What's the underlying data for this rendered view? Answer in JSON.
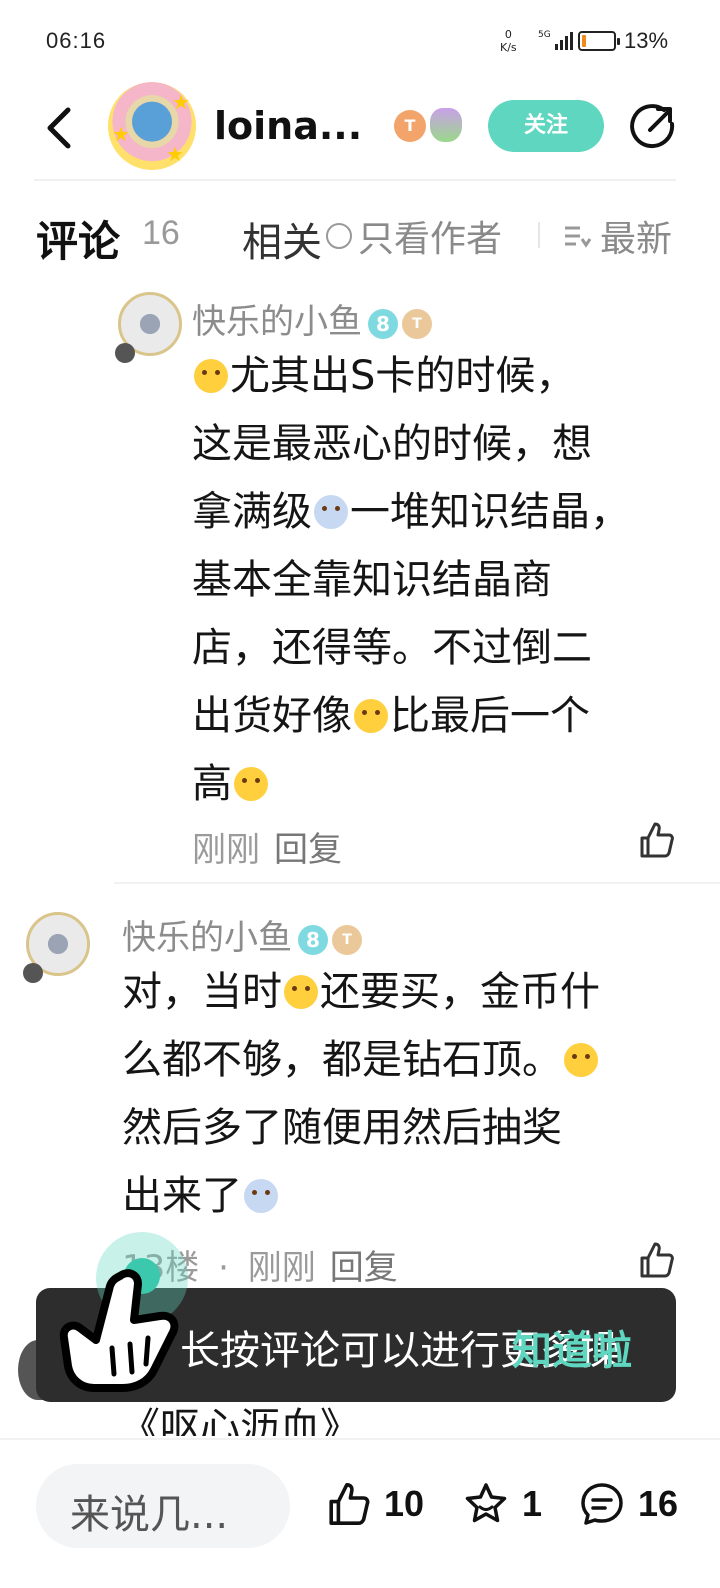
{
  "status_bar": {
    "time": "06:16",
    "net_speed_value": "0",
    "net_speed_unit": "K/s",
    "signal_label": "5G",
    "battery_percent": "13%",
    "battery_level": 0.13
  },
  "header": {
    "username": "loina...",
    "badge_t_label": "T",
    "follow_label": "关注"
  },
  "tabs": {
    "comments_label": "评论",
    "comments_count": "16",
    "related_label": "相关",
    "author_only_label": "只看作者",
    "sort_label": "最新"
  },
  "comments": [
    {
      "name": "快乐的小鱼",
      "level": "8",
      "t_badge": "T",
      "lines": [
        "尤其出S卡的时候，",
        "这是最恶心的时候，想",
        "拿满级",
        "一堆知识结晶，",
        "基本全靠知识结晶商",
        "店，还得等。不过倒二",
        "出货好像",
        "比最后一个",
        "高"
      ],
      "time": "刚刚",
      "reply_label": "回复"
    },
    {
      "name": "快乐的小鱼",
      "level": "8",
      "t_badge": "T",
      "lines": [
        "对，当时",
        "还要买，金币什",
        "么都不够，都是钻石顶。",
        "然后多了随便用然后抽奖",
        "出来了"
      ],
      "floor": "13楼",
      "separator": "·",
      "time": "刚刚",
      "reply_label": "回复"
    }
  ],
  "toast": {
    "text": "长按评论可以进行更多操",
    "ok_label": "知道啦"
  },
  "partial_next_comment": "《呕心沥血》",
  "bottom_bar": {
    "input_placeholder": "来说几...",
    "likes": "10",
    "favorites": "1",
    "comments": "16"
  }
}
